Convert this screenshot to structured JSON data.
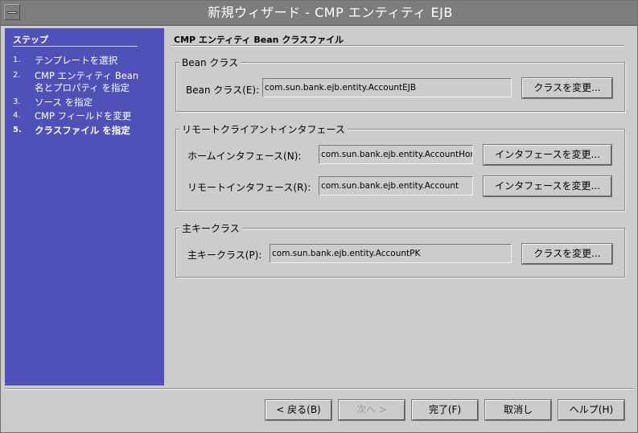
{
  "window": {
    "title": "新規ウィザード - CMP エンティティ EJB"
  },
  "steps": {
    "heading": "ステップ",
    "items": [
      {
        "num": "1.",
        "label": "テンプレートを選択"
      },
      {
        "num": "2.",
        "label": "CMP エンティティ Bean",
        "label2": "名とプロパティ を指定"
      },
      {
        "num": "3.",
        "label": "ソース を指定"
      },
      {
        "num": "4.",
        "label": "CMP フィールドを変更"
      },
      {
        "num": "5.",
        "label": "クラスファイル を指定"
      }
    ]
  },
  "panel": {
    "title": "CMP エンティティ Bean クラスファイル",
    "bean_group": {
      "legend": "Bean クラス",
      "label": "Bean クラス(E):",
      "value": "com.sun.bank.ejb.entity.AccountEJB",
      "button": "クラスを変更..."
    },
    "remote_group": {
      "legend": "リモートクライアントインタフェース",
      "home_label": "ホームインタフェース(N):",
      "home_value": "com.sun.bank.ejb.entity.AccountHome",
      "home_button": "インタフェースを変更...",
      "remote_label": "リモートインタフェース(R):",
      "remote_value": "com.sun.bank.ejb.entity.Account",
      "remote_button": "インタフェースを変更..."
    },
    "pk_group": {
      "legend": "主キークラス",
      "label": "主キークラス(P):",
      "value": "com.sun.bank.ejb.entity.AccountPK",
      "button": "クラスを変更..."
    }
  },
  "footer": {
    "back": "< 戻る(B)",
    "next": "次へ >",
    "finish": "完了(F)",
    "cancel": "取消し",
    "help": "ヘルプ(H)"
  }
}
